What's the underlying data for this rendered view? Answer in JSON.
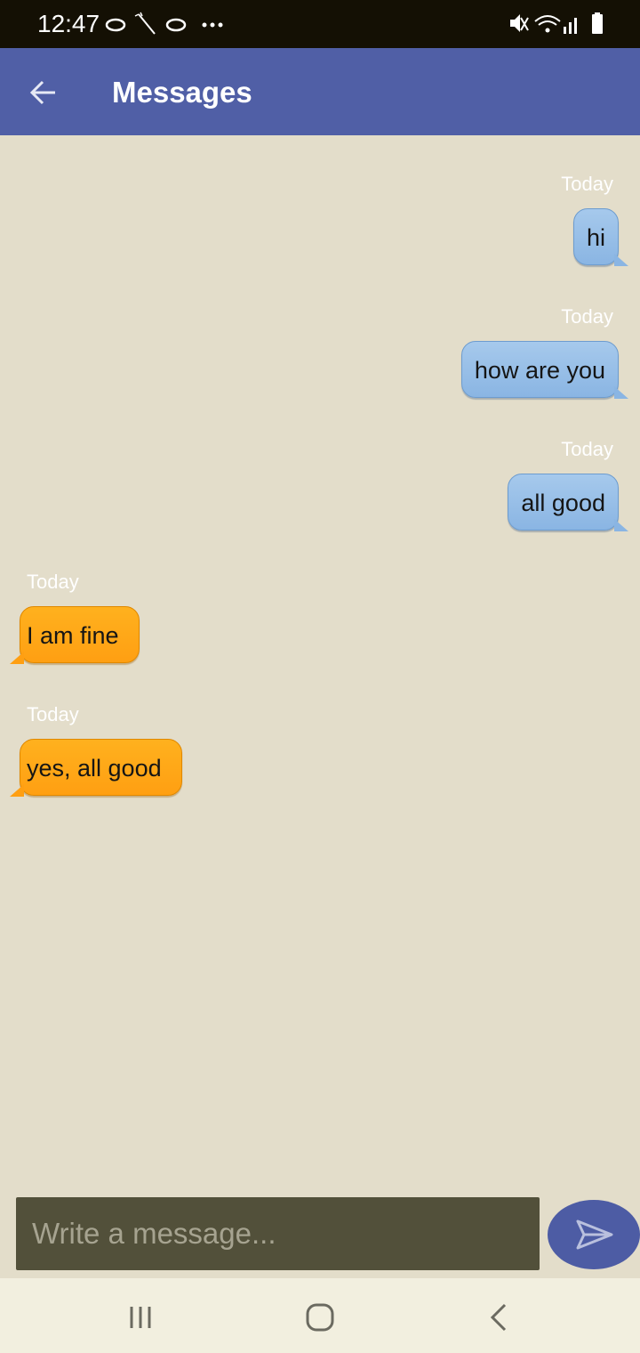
{
  "status_bar": {
    "time": "12:47"
  },
  "app_bar": {
    "title": "Messages",
    "back_icon": "arrow-left-icon"
  },
  "messages": [
    {
      "direction": "sent",
      "time": "Today",
      "text": "hi"
    },
    {
      "direction": "sent",
      "time": "Today",
      "text": "how are you"
    },
    {
      "direction": "sent",
      "time": "Today",
      "text": "all good"
    },
    {
      "direction": "received",
      "time": "Today",
      "text": "I am fine"
    },
    {
      "direction": "received",
      "time": "Today",
      "text": "yes, all good"
    }
  ],
  "composer": {
    "placeholder": "Write a message...",
    "send_icon": "send-icon"
  },
  "colors": {
    "app_bar": "#505fa6",
    "chat_background": "#e3ddca",
    "sent_bubble": "#8ab5e3",
    "received_bubble": "#ff9f12",
    "input_background": "#52503a"
  }
}
